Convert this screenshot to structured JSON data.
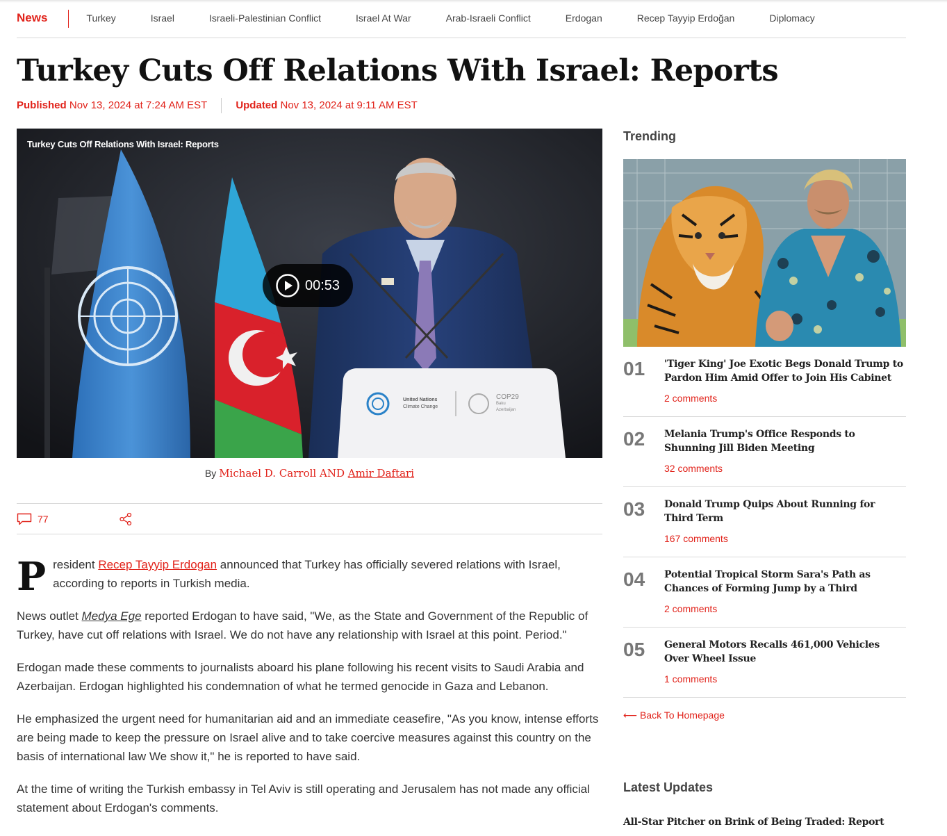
{
  "nav": {
    "brand": "News",
    "items": [
      "Turkey",
      "Israel",
      "Israeli-Palestinian Conflict",
      "Israel At War",
      "Arab-Israeli Conflict",
      "Erdogan",
      "Recep Tayyip Erdoğan",
      "Diplomacy"
    ]
  },
  "article": {
    "headline": "Turkey Cuts Off Relations With Israel: Reports",
    "published_label": "Published",
    "published_date": "Nov 13, 2024 at 7:24 AM EST",
    "updated_label": "Updated",
    "updated_date": "Nov 13, 2024 at 9:11 AM EST",
    "video": {
      "title": "Turkey Cuts Off Relations With Israel: Reports",
      "duration": "00:53",
      "podium_text_1": "United Nations",
      "podium_text_2": "Climate Change",
      "podium_cop": "COP29",
      "podium_cop_sub1": "Baku",
      "podium_cop_sub2": "Azerbaijan"
    },
    "byline_prefix": "By",
    "author_1": "Michael D. Carroll",
    "author_joiner": "AND",
    "author_2": "Amir Daftari",
    "comment_count": "77",
    "dropcap": "P",
    "p1_a": "resident ",
    "p1_link": "Recep Tayyip Erdogan",
    "p1_b": " announced that Turkey has officially severed relations with Israel, according to reports in Turkish media.",
    "p2_a": "News outlet ",
    "p2_link": "Medya Ege",
    "p2_b": " reported Erdogan to have said, \"We, as the State and Government of the Republic of Turkey, have cut off relations with Israel. We do not have any relationship with Israel at this point. Period.\"",
    "p3": "Erdogan made these comments to journalists aboard his plane following his recent visits to Saudi Arabia and Azerbaijan. Erdogan highlighted his condemnation of what he termed genocide in Gaza and Lebanon.",
    "p4": "He emphasized the urgent need for humanitarian aid and an immediate ceasefire, \"As you know, intense efforts are being made to keep the pressure on Israel alive and to take coercive measures against this country on the basis of international law We show it,\" he is reported to have said.",
    "p5": "At the time of writing the Turkish embassy in Tel Aviv is still operating and Jerusalem has not made any official statement about Erdogan's comments."
  },
  "sidebar": {
    "trending_heading": "Trending",
    "trending": [
      {
        "num": "01",
        "title": "'Tiger King' Joe Exotic Begs Donald Trump to Pardon Him Amid Offer to Join His Cabinet",
        "comments": "2 comments"
      },
      {
        "num": "02",
        "title": "Melania Trump's Office Responds to Shunning Jill Biden Meeting",
        "comments": "32 comments"
      },
      {
        "num": "03",
        "title": "Donald Trump Quips About Running for Third Term",
        "comments": "167 comments"
      },
      {
        "num": "04",
        "title": "Potential Tropical Storm Sara's Path as Chances of Forming Jump by a Third",
        "comments": "2 comments"
      },
      {
        "num": "05",
        "title": "General Motors Recalls 461,000 Vehicles Over Wheel Issue",
        "comments": "1 comments"
      }
    ],
    "back_home": "⟵ Back To Homepage",
    "latest_heading": "Latest Updates",
    "latest_first": "All-Star Pitcher on Brink of Being Traded: Report"
  },
  "colors": {
    "accent": "#e1231b",
    "text": "#333333",
    "divider": "#d9d9d9"
  }
}
